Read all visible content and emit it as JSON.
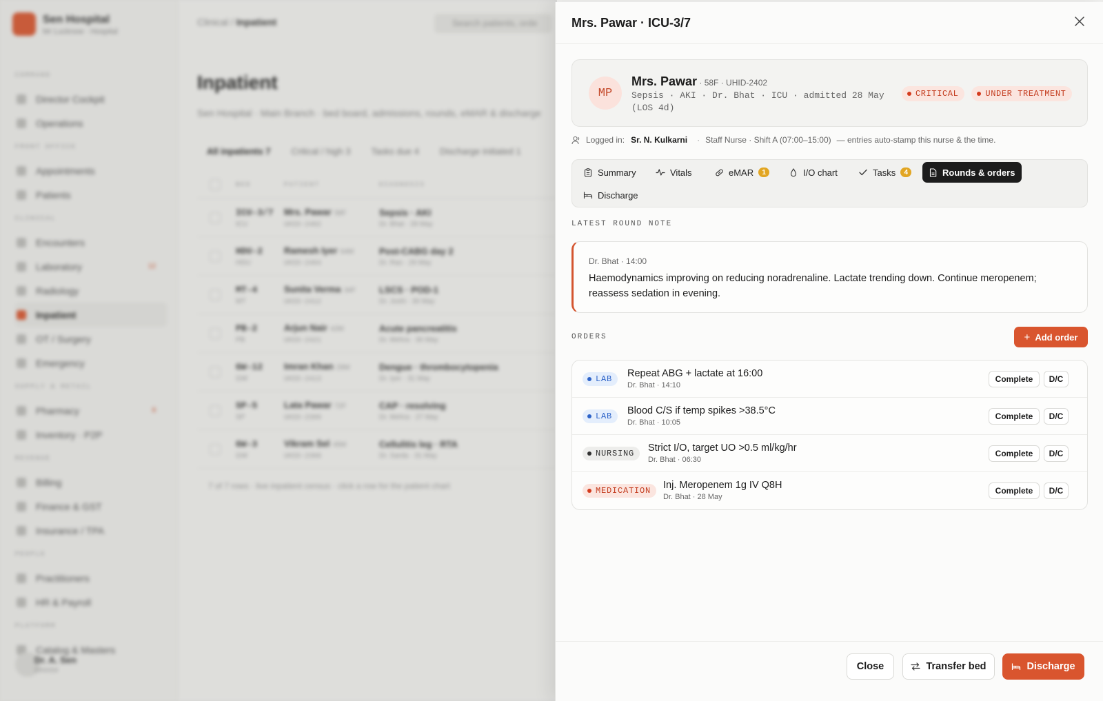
{
  "background": {
    "brand": "Sen Hospital",
    "brand_sub": "Mr Lucknow · Hospital",
    "breadcrumb_prefix": "Clinical / ",
    "breadcrumb_current": "Inpatient",
    "search_placeholder": "Search patients, orde",
    "page_title": "Inpatient",
    "page_subtitle": "Sen Hospital · Main Branch · bed board, admissions, rounds, eMAR & discharge",
    "nav": [
      {
        "section": "COMMAND",
        "items": [
          {
            "label": "Director Cockpit"
          },
          {
            "label": "Operations"
          }
        ]
      },
      {
        "section": "FRONT OFFICE",
        "items": [
          {
            "label": "Appointments"
          },
          {
            "label": "Patients"
          }
        ]
      },
      {
        "section": "CLINICAL",
        "items": [
          {
            "label": "Encounters"
          },
          {
            "label": "Laboratory",
            "badge": "12"
          },
          {
            "label": "Radiology"
          },
          {
            "label": "Inpatient",
            "active": true
          },
          {
            "label": "OT / Surgery"
          },
          {
            "label": "Emergency"
          }
        ]
      },
      {
        "section": "SUPPLY & RETAIL",
        "items": [
          {
            "label": "Pharmacy",
            "badge": "8"
          },
          {
            "label": "Inventory · P2P"
          }
        ]
      },
      {
        "section": "REVENUE",
        "items": [
          {
            "label": "Billing"
          },
          {
            "label": "Finance & GST"
          },
          {
            "label": "Insurance / TPA"
          }
        ]
      },
      {
        "section": "PEOPLE",
        "items": [
          {
            "label": "Practitioners"
          },
          {
            "label": "HR & Payroll"
          }
        ]
      },
      {
        "section": "PLATFORM",
        "items": [
          {
            "label": "Catalog & Masters"
          }
        ]
      }
    ],
    "user_name": "Dr. A. Sen",
    "user_role": "Director",
    "filter_tabs": [
      "All inpatients 7",
      "Critical / high 3",
      "Tasks due 4",
      "Discharge initiated 1"
    ],
    "table_headers": [
      "BED",
      "PATIENT",
      "DIAGNOSIS"
    ],
    "rows": [
      {
        "bed": "ICU-3/7",
        "ward": "ICU",
        "patient": "Mrs. Pawar",
        "age": "58F",
        "uhid": "UHID-2402",
        "dx": "Sepsis · AKI",
        "dx_sub": "Dr. Bhat · 28 May"
      },
      {
        "bed": "HDU-2",
        "ward": "HDU",
        "patient": "Ramesh Iyer",
        "age": "64M",
        "uhid": "UHID-2404",
        "dx": "Post-CABG day 2",
        "dx_sub": "Dr. Rao · 29 May"
      },
      {
        "bed": "MT-4",
        "ward": "MT",
        "patient": "Sunita Verma",
        "age": "34F",
        "uhid": "UHID-2412",
        "dx": "LSCS · POD-1",
        "dx_sub": "Dr. Joshi · 30 May"
      },
      {
        "bed": "PB-2",
        "ward": "PB",
        "patient": "Arjun Nair",
        "age": "42M",
        "uhid": "UHID-2421",
        "dx": "Acute pancreatitis",
        "dx_sub": "Dr. Mehra · 30 May"
      },
      {
        "bed": "GW-12",
        "ward": "GW",
        "patient": "Imran Khan",
        "age": "29M",
        "uhid": "UHID-2413",
        "dx": "Dengue · thrombocytopenia",
        "dx_sub": "Dr. Iyer · 31 May"
      },
      {
        "bed": "SP-5",
        "ward": "SP",
        "patient": "Lata Pawar",
        "age": "72F",
        "uhid": "UHID-2399",
        "dx": "CAP · resolving",
        "dx_sub": "Dr. Mehra · 27 May"
      },
      {
        "bed": "GW-3",
        "ward": "GW",
        "patient": "Vikram Sel",
        "age": "45M",
        "uhid": "UHID-2368",
        "dx": "Cellulitis leg · RTA",
        "dx_sub": "Dr. Sarda · 31 May"
      }
    ],
    "footer": "7 of 7 rows · live inpatient census · click a row for the patient chart"
  },
  "drawer": {
    "title": "Mrs. Pawar · ICU-3/7",
    "patient": {
      "initials": "MP",
      "name": "Mrs. Pawar",
      "meta": " · 58F · UHID-2402",
      "details": "Sepsis · AKI · Dr. Bhat · ICU · admitted 28 May (LOS 4d)",
      "tags": [
        "CRITICAL",
        "UNDER TREATMENT"
      ]
    },
    "logged": {
      "label": "Logged in:",
      "nurse": "Sr. N. Kulkarni",
      "role": "Staff Nurse · Shift A (07:00–15:00)",
      "note": "— entries auto-stamp this nurse & the time."
    },
    "tabs": [
      {
        "label": "Summary",
        "icon": "clipboard-icon"
      },
      {
        "label": "Vitals",
        "icon": "pulse-icon"
      },
      {
        "label": "eMAR",
        "icon": "pill-icon",
        "count": "1"
      },
      {
        "label": "I/O chart",
        "icon": "droplet-icon"
      },
      {
        "label": "Tasks",
        "icon": "check-icon",
        "count": "4"
      },
      {
        "label": "Rounds & orders",
        "icon": "document-icon",
        "active": true
      },
      {
        "label": "Discharge",
        "icon": "bed-icon"
      }
    ],
    "round_note": {
      "section_label": "LATEST ROUND NOTE",
      "meta": "Dr. Bhat · 14:00",
      "text": "Haemodynamics improving on reducing noradrenaline. Lactate trending down. Continue meropenem; reassess sedation in evening."
    },
    "orders": {
      "section_label": "ORDERS",
      "add_label": "Add order",
      "complete_label": "Complete",
      "dc_label": "D/C",
      "items": [
        {
          "type": "LAB",
          "title": "Repeat ABG + lactate at 16:00",
          "meta": "Dr. Bhat · 14:10"
        },
        {
          "type": "LAB",
          "title": "Blood C/S if temp spikes >38.5°C",
          "meta": "Dr. Bhat · 10:05"
        },
        {
          "type": "NURSING",
          "title": "Strict I/O, target UO >0.5 ml/kg/hr",
          "meta": "Dr. Bhat · 06:30"
        },
        {
          "type": "MEDICATION",
          "title": "Inj. Meropenem 1g IV Q8H",
          "meta": "Dr. Bhat · 28 May"
        }
      ]
    },
    "footer": {
      "close": "Close",
      "transfer": "Transfer bed",
      "discharge": "Discharge"
    }
  },
  "colors": {
    "accent": "#d9552e",
    "critical": "#c33a1c",
    "lab": "#2d63c8",
    "badge": "#e2a623"
  }
}
